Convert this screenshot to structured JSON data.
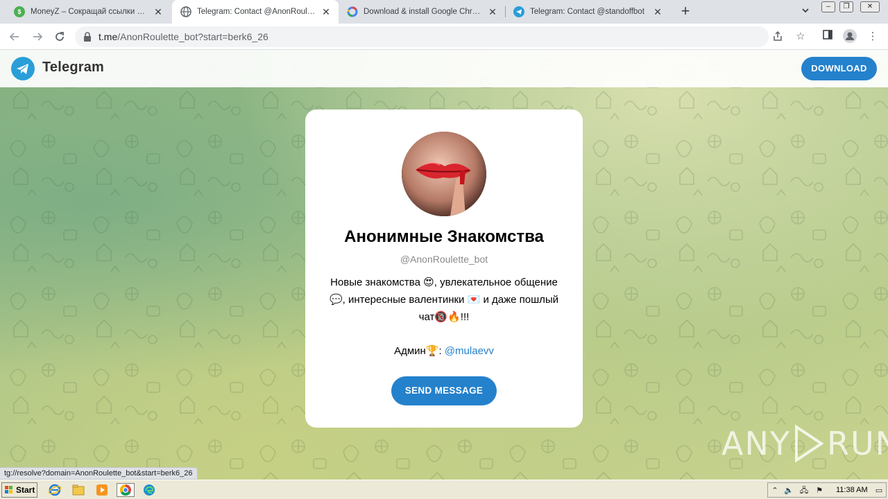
{
  "browser": {
    "tabs": [
      {
        "title": "MoneyZ – Сокращай ссылки и зарабатывай",
        "favicon": "moneyz-icon",
        "active": false
      },
      {
        "title": "Telegram: Contact @AnonRoulette_bot",
        "favicon": "globe-icon",
        "active": true
      },
      {
        "title": "Download & install Google Chrome - Google",
        "favicon": "google-icon",
        "active": false
      },
      {
        "title": "Telegram: Contact @standoffbot",
        "favicon": "telegram-icon",
        "active": false
      }
    ],
    "new_tab_label": "+",
    "url_host": "t.me",
    "url_path": "/AnonRoulette_bot?start=berk6_26",
    "status_url": "tg://resolve?domain=AnonRoulette_bot&start=berk6_26"
  },
  "telegram": {
    "brand": "Telegram",
    "download_label": "DOWNLOAD",
    "bot_name": "Анонимные Знакомства",
    "bot_handle": "@AnonRoulette_bot",
    "description_line1": "Новые знакомства 😍, увлекательное общение",
    "description_line2": "💬, интересные валентинки 💌 и даже пошлый",
    "description_line3": "чат🔞🔥!!!",
    "admin_prefix": "Админ🏆: ",
    "admin_mention": "@mulaevv",
    "send_label": "SEND MESSAGE",
    "accent_color": "#2481cc"
  },
  "watermark": {
    "left": "ANY",
    "right": "RUN"
  },
  "taskbar": {
    "start_label": "Start",
    "apps": [
      "ie-icon",
      "explorer-icon",
      "media-player-icon",
      "chrome-icon",
      "edge-icon"
    ],
    "clock": "11:38 AM"
  }
}
